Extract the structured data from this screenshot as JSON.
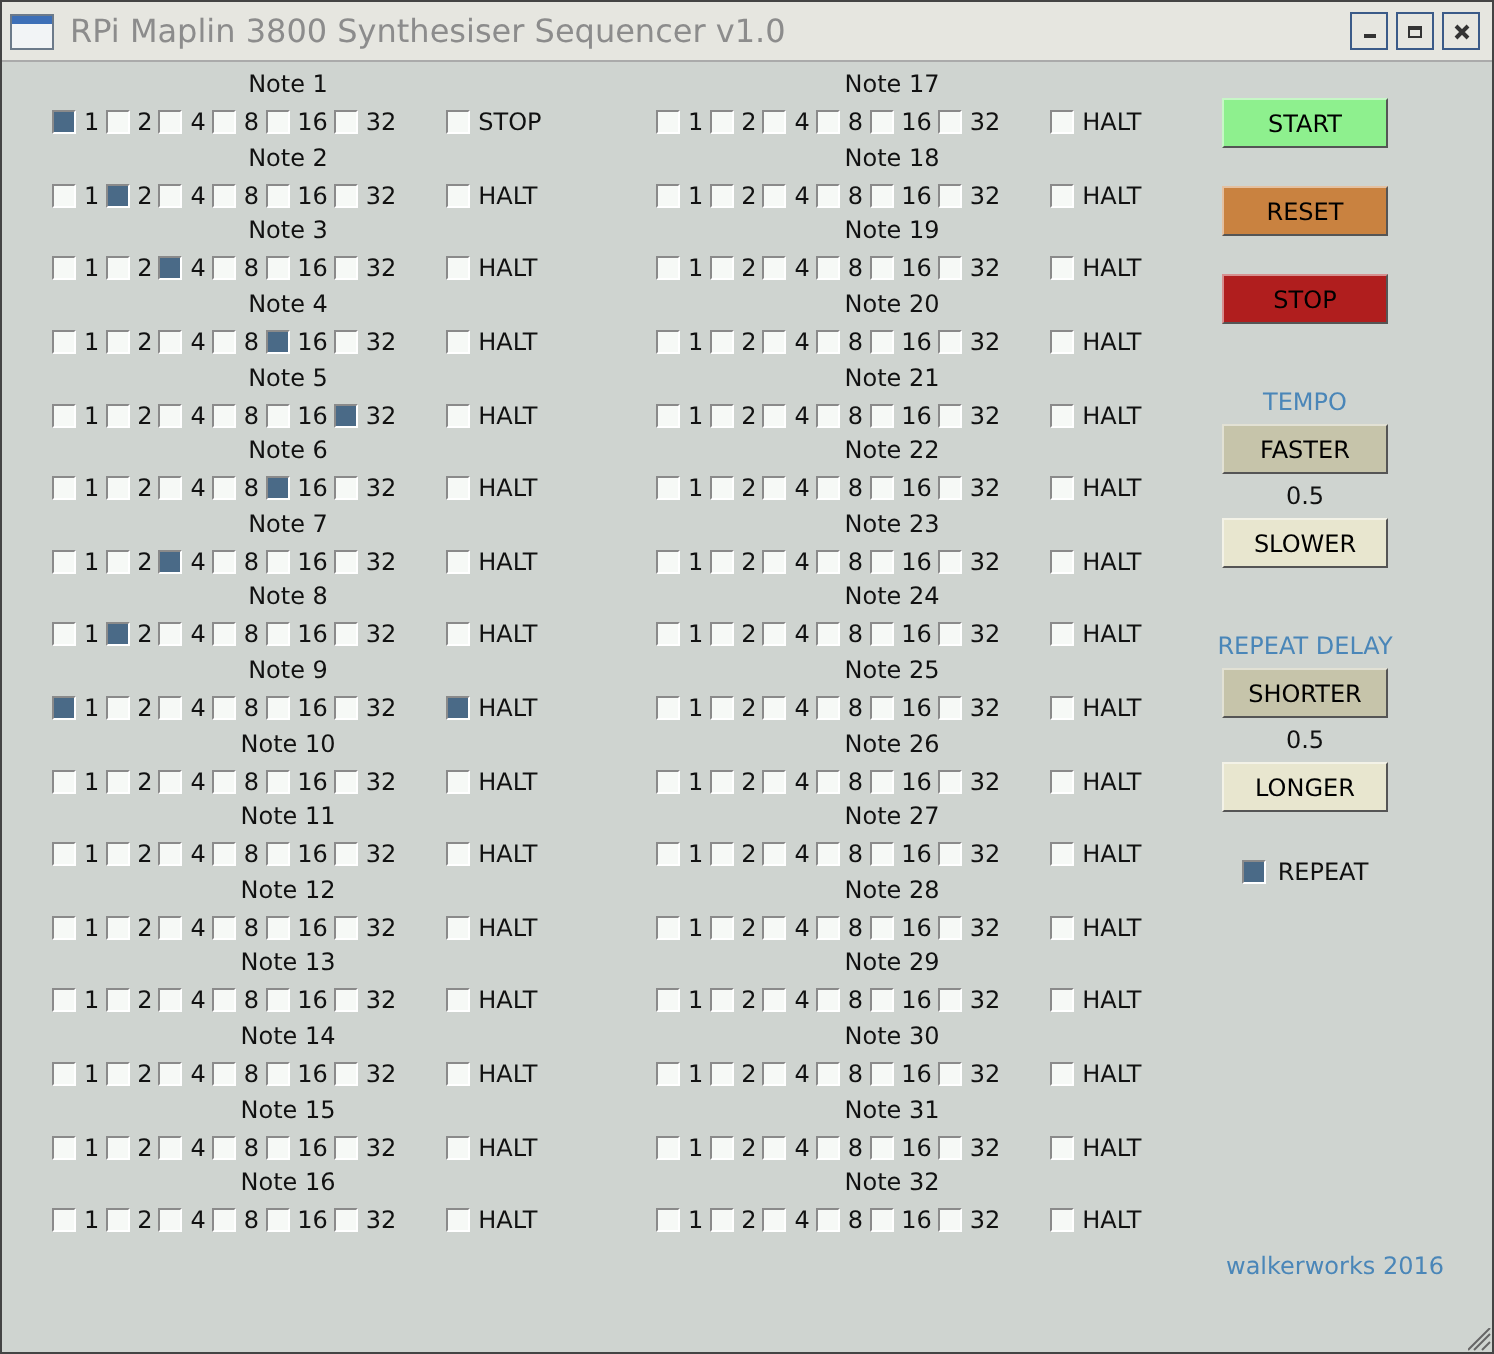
{
  "window": {
    "title": "RPi Maplin 3800 Synthesiser Sequencer v1.0"
  },
  "notes": [
    {
      "label": "Note 1",
      "options": [
        {
          "label": "1",
          "checked": true
        },
        {
          "label": "2",
          "checked": false
        },
        {
          "label": "4",
          "checked": false
        },
        {
          "label": "8",
          "checked": false
        },
        {
          "label": "16",
          "checked": false
        },
        {
          "label": "32",
          "checked": false
        }
      ],
      "halt": {
        "label": "STOP",
        "checked": false
      }
    },
    {
      "label": "Note 2",
      "options": [
        {
          "label": "1",
          "checked": false
        },
        {
          "label": "2",
          "checked": true
        },
        {
          "label": "4",
          "checked": false
        },
        {
          "label": "8",
          "checked": false
        },
        {
          "label": "16",
          "checked": false
        },
        {
          "label": "32",
          "checked": false
        }
      ],
      "halt": {
        "label": "HALT",
        "checked": false
      }
    },
    {
      "label": "Note 3",
      "options": [
        {
          "label": "1",
          "checked": false
        },
        {
          "label": "2",
          "checked": false
        },
        {
          "label": "4",
          "checked": true
        },
        {
          "label": "8",
          "checked": false
        },
        {
          "label": "16",
          "checked": false
        },
        {
          "label": "32",
          "checked": false
        }
      ],
      "halt": {
        "label": "HALT",
        "checked": false
      }
    },
    {
      "label": "Note 4",
      "options": [
        {
          "label": "1",
          "checked": false
        },
        {
          "label": "2",
          "checked": false
        },
        {
          "label": "4",
          "checked": false
        },
        {
          "label": "8",
          "checked": false
        },
        {
          "label": "16",
          "checked": true
        },
        {
          "label": "32",
          "checked": false
        }
      ],
      "halt": {
        "label": "HALT",
        "checked": false
      }
    },
    {
      "label": "Note 5",
      "options": [
        {
          "label": "1",
          "checked": false
        },
        {
          "label": "2",
          "checked": false
        },
        {
          "label": "4",
          "checked": false
        },
        {
          "label": "8",
          "checked": false
        },
        {
          "label": "16",
          "checked": false
        },
        {
          "label": "32",
          "checked": true
        }
      ],
      "halt": {
        "label": "HALT",
        "checked": false
      }
    },
    {
      "label": "Note 6",
      "options": [
        {
          "label": "1",
          "checked": false
        },
        {
          "label": "2",
          "checked": false
        },
        {
          "label": "4",
          "checked": false
        },
        {
          "label": "8",
          "checked": false
        },
        {
          "label": "16",
          "checked": true
        },
        {
          "label": "32",
          "checked": false
        }
      ],
      "halt": {
        "label": "HALT",
        "checked": false
      }
    },
    {
      "label": "Note 7",
      "options": [
        {
          "label": "1",
          "checked": false
        },
        {
          "label": "2",
          "checked": false
        },
        {
          "label": "4",
          "checked": true
        },
        {
          "label": "8",
          "checked": false
        },
        {
          "label": "16",
          "checked": false
        },
        {
          "label": "32",
          "checked": false
        }
      ],
      "halt": {
        "label": "HALT",
        "checked": false
      }
    },
    {
      "label": "Note 8",
      "options": [
        {
          "label": "1",
          "checked": false
        },
        {
          "label": "2",
          "checked": true
        },
        {
          "label": "4",
          "checked": false
        },
        {
          "label": "8",
          "checked": false
        },
        {
          "label": "16",
          "checked": false
        },
        {
          "label": "32",
          "checked": false
        }
      ],
      "halt": {
        "label": "HALT",
        "checked": false
      }
    },
    {
      "label": "Note 9",
      "options": [
        {
          "label": "1",
          "checked": true
        },
        {
          "label": "2",
          "checked": false
        },
        {
          "label": "4",
          "checked": false
        },
        {
          "label": "8",
          "checked": false
        },
        {
          "label": "16",
          "checked": false
        },
        {
          "label": "32",
          "checked": false
        }
      ],
      "halt": {
        "label": "HALT",
        "checked": true
      }
    },
    {
      "label": "Note 10",
      "options": [
        {
          "label": "1",
          "checked": false
        },
        {
          "label": "2",
          "checked": false
        },
        {
          "label": "4",
          "checked": false
        },
        {
          "label": "8",
          "checked": false
        },
        {
          "label": "16",
          "checked": false
        },
        {
          "label": "32",
          "checked": false
        }
      ],
      "halt": {
        "label": "HALT",
        "checked": false
      }
    },
    {
      "label": "Note 11",
      "options": [
        {
          "label": "1",
          "checked": false
        },
        {
          "label": "2",
          "checked": false
        },
        {
          "label": "4",
          "checked": false
        },
        {
          "label": "8",
          "checked": false
        },
        {
          "label": "16",
          "checked": false
        },
        {
          "label": "32",
          "checked": false
        }
      ],
      "halt": {
        "label": "HALT",
        "checked": false
      }
    },
    {
      "label": "Note 12",
      "options": [
        {
          "label": "1",
          "checked": false
        },
        {
          "label": "2",
          "checked": false
        },
        {
          "label": "4",
          "checked": false
        },
        {
          "label": "8",
          "checked": false
        },
        {
          "label": "16",
          "checked": false
        },
        {
          "label": "32",
          "checked": false
        }
      ],
      "halt": {
        "label": "HALT",
        "checked": false
      }
    },
    {
      "label": "Note 13",
      "options": [
        {
          "label": "1",
          "checked": false
        },
        {
          "label": "2",
          "checked": false
        },
        {
          "label": "4",
          "checked": false
        },
        {
          "label": "8",
          "checked": false
        },
        {
          "label": "16",
          "checked": false
        },
        {
          "label": "32",
          "checked": false
        }
      ],
      "halt": {
        "label": "HALT",
        "checked": false
      }
    },
    {
      "label": "Note 14",
      "options": [
        {
          "label": "1",
          "checked": false
        },
        {
          "label": "2",
          "checked": false
        },
        {
          "label": "4",
          "checked": false
        },
        {
          "label": "8",
          "checked": false
        },
        {
          "label": "16",
          "checked": false
        },
        {
          "label": "32",
          "checked": false
        }
      ],
      "halt": {
        "label": "HALT",
        "checked": false
      }
    },
    {
      "label": "Note 15",
      "options": [
        {
          "label": "1",
          "checked": false
        },
        {
          "label": "2",
          "checked": false
        },
        {
          "label": "4",
          "checked": false
        },
        {
          "label": "8",
          "checked": false
        },
        {
          "label": "16",
          "checked": false
        },
        {
          "label": "32",
          "checked": false
        }
      ],
      "halt": {
        "label": "HALT",
        "checked": false
      }
    },
    {
      "label": "Note 16",
      "options": [
        {
          "label": "1",
          "checked": false
        },
        {
          "label": "2",
          "checked": false
        },
        {
          "label": "4",
          "checked": false
        },
        {
          "label": "8",
          "checked": false
        },
        {
          "label": "16",
          "checked": false
        },
        {
          "label": "32",
          "checked": false
        }
      ],
      "halt": {
        "label": "HALT",
        "checked": false
      }
    },
    {
      "label": "Note 17",
      "options": [
        {
          "label": "1",
          "checked": false
        },
        {
          "label": "2",
          "checked": false
        },
        {
          "label": "4",
          "checked": false
        },
        {
          "label": "8",
          "checked": false
        },
        {
          "label": "16",
          "checked": false
        },
        {
          "label": "32",
          "checked": false
        }
      ],
      "halt": {
        "label": "HALT",
        "checked": false
      }
    },
    {
      "label": "Note 18",
      "options": [
        {
          "label": "1",
          "checked": false
        },
        {
          "label": "2",
          "checked": false
        },
        {
          "label": "4",
          "checked": false
        },
        {
          "label": "8",
          "checked": false
        },
        {
          "label": "16",
          "checked": false
        },
        {
          "label": "32",
          "checked": false
        }
      ],
      "halt": {
        "label": "HALT",
        "checked": false
      }
    },
    {
      "label": "Note 19",
      "options": [
        {
          "label": "1",
          "checked": false
        },
        {
          "label": "2",
          "checked": false
        },
        {
          "label": "4",
          "checked": false
        },
        {
          "label": "8",
          "checked": false
        },
        {
          "label": "16",
          "checked": false
        },
        {
          "label": "32",
          "checked": false
        }
      ],
      "halt": {
        "label": "HALT",
        "checked": false
      }
    },
    {
      "label": "Note 20",
      "options": [
        {
          "label": "1",
          "checked": false
        },
        {
          "label": "2",
          "checked": false
        },
        {
          "label": "4",
          "checked": false
        },
        {
          "label": "8",
          "checked": false
        },
        {
          "label": "16",
          "checked": false
        },
        {
          "label": "32",
          "checked": false
        }
      ],
      "halt": {
        "label": "HALT",
        "checked": false
      }
    },
    {
      "label": "Note 21",
      "options": [
        {
          "label": "1",
          "checked": false
        },
        {
          "label": "2",
          "checked": false
        },
        {
          "label": "4",
          "checked": false
        },
        {
          "label": "8",
          "checked": false
        },
        {
          "label": "16",
          "checked": false
        },
        {
          "label": "32",
          "checked": false
        }
      ],
      "halt": {
        "label": "HALT",
        "checked": false
      }
    },
    {
      "label": "Note 22",
      "options": [
        {
          "label": "1",
          "checked": false
        },
        {
          "label": "2",
          "checked": false
        },
        {
          "label": "4",
          "checked": false
        },
        {
          "label": "8",
          "checked": false
        },
        {
          "label": "16",
          "checked": false
        },
        {
          "label": "32",
          "checked": false
        }
      ],
      "halt": {
        "label": "HALT",
        "checked": false
      }
    },
    {
      "label": "Note 23",
      "options": [
        {
          "label": "1",
          "checked": false
        },
        {
          "label": "2",
          "checked": false
        },
        {
          "label": "4",
          "checked": false
        },
        {
          "label": "8",
          "checked": false
        },
        {
          "label": "16",
          "checked": false
        },
        {
          "label": "32",
          "checked": false
        }
      ],
      "halt": {
        "label": "HALT",
        "checked": false
      }
    },
    {
      "label": "Note 24",
      "options": [
        {
          "label": "1",
          "checked": false
        },
        {
          "label": "2",
          "checked": false
        },
        {
          "label": "4",
          "checked": false
        },
        {
          "label": "8",
          "checked": false
        },
        {
          "label": "16",
          "checked": false
        },
        {
          "label": "32",
          "checked": false
        }
      ],
      "halt": {
        "label": "HALT",
        "checked": false
      }
    },
    {
      "label": "Note 25",
      "options": [
        {
          "label": "1",
          "checked": false
        },
        {
          "label": "2",
          "checked": false
        },
        {
          "label": "4",
          "checked": false
        },
        {
          "label": "8",
          "checked": false
        },
        {
          "label": "16",
          "checked": false
        },
        {
          "label": "32",
          "checked": false
        }
      ],
      "halt": {
        "label": "HALT",
        "checked": false
      }
    },
    {
      "label": "Note 26",
      "options": [
        {
          "label": "1",
          "checked": false
        },
        {
          "label": "2",
          "checked": false
        },
        {
          "label": "4",
          "checked": false
        },
        {
          "label": "8",
          "checked": false
        },
        {
          "label": "16",
          "checked": false
        },
        {
          "label": "32",
          "checked": false
        }
      ],
      "halt": {
        "label": "HALT",
        "checked": false
      }
    },
    {
      "label": "Note 27",
      "options": [
        {
          "label": "1",
          "checked": false
        },
        {
          "label": "2",
          "checked": false
        },
        {
          "label": "4",
          "checked": false
        },
        {
          "label": "8",
          "checked": false
        },
        {
          "label": "16",
          "checked": false
        },
        {
          "label": "32",
          "checked": false
        }
      ],
      "halt": {
        "label": "HALT",
        "checked": false
      }
    },
    {
      "label": "Note 28",
      "options": [
        {
          "label": "1",
          "checked": false
        },
        {
          "label": "2",
          "checked": false
        },
        {
          "label": "4",
          "checked": false
        },
        {
          "label": "8",
          "checked": false
        },
        {
          "label": "16",
          "checked": false
        },
        {
          "label": "32",
          "checked": false
        }
      ],
      "halt": {
        "label": "HALT",
        "checked": false
      }
    },
    {
      "label": "Note 29",
      "options": [
        {
          "label": "1",
          "checked": false
        },
        {
          "label": "2",
          "checked": false
        },
        {
          "label": "4",
          "checked": false
        },
        {
          "label": "8",
          "checked": false
        },
        {
          "label": "16",
          "checked": false
        },
        {
          "label": "32",
          "checked": false
        }
      ],
      "halt": {
        "label": "HALT",
        "checked": false
      }
    },
    {
      "label": "Note 30",
      "options": [
        {
          "label": "1",
          "checked": false
        },
        {
          "label": "2",
          "checked": false
        },
        {
          "label": "4",
          "checked": false
        },
        {
          "label": "8",
          "checked": false
        },
        {
          "label": "16",
          "checked": false
        },
        {
          "label": "32",
          "checked": false
        }
      ],
      "halt": {
        "label": "HALT",
        "checked": false
      }
    },
    {
      "label": "Note 31",
      "options": [
        {
          "label": "1",
          "checked": false
        },
        {
          "label": "2",
          "checked": false
        },
        {
          "label": "4",
          "checked": false
        },
        {
          "label": "8",
          "checked": false
        },
        {
          "label": "16",
          "checked": false
        },
        {
          "label": "32",
          "checked": false
        }
      ],
      "halt": {
        "label": "HALT",
        "checked": false
      }
    },
    {
      "label": "Note 32",
      "options": [
        {
          "label": "1",
          "checked": false
        },
        {
          "label": "2",
          "checked": false
        },
        {
          "label": "4",
          "checked": false
        },
        {
          "label": "8",
          "checked": false
        },
        {
          "label": "16",
          "checked": false
        },
        {
          "label": "32",
          "checked": false
        }
      ],
      "halt": {
        "label": "HALT",
        "checked": false
      }
    }
  ],
  "controls": [
    {
      "kind": "button",
      "label": "START",
      "color": "#8ef08e"
    },
    {
      "kind": "button",
      "label": "RESET",
      "color": "#c98240"
    },
    {
      "kind": "button",
      "label": "STOP",
      "color": "#b01e1e"
    },
    {
      "kind": "heading",
      "label": "TEMPO"
    },
    {
      "kind": "button",
      "label": "FASTER",
      "color": "#c6c4aa"
    },
    {
      "kind": "value",
      "label": "0.5"
    },
    {
      "kind": "button",
      "label": "SLOWER",
      "color": "#e8e6cf"
    },
    {
      "kind": "heading",
      "label": "REPEAT DELAY"
    },
    {
      "kind": "button",
      "label": "SHORTER",
      "color": "#c6c4aa"
    },
    {
      "kind": "value",
      "label": "0.5"
    },
    {
      "kind": "button",
      "label": "LONGER",
      "color": "#e8e6cf"
    },
    {
      "kind": "checkbox",
      "label": "REPEAT",
      "checked": true
    }
  ],
  "footer": "walkerworks 2016"
}
